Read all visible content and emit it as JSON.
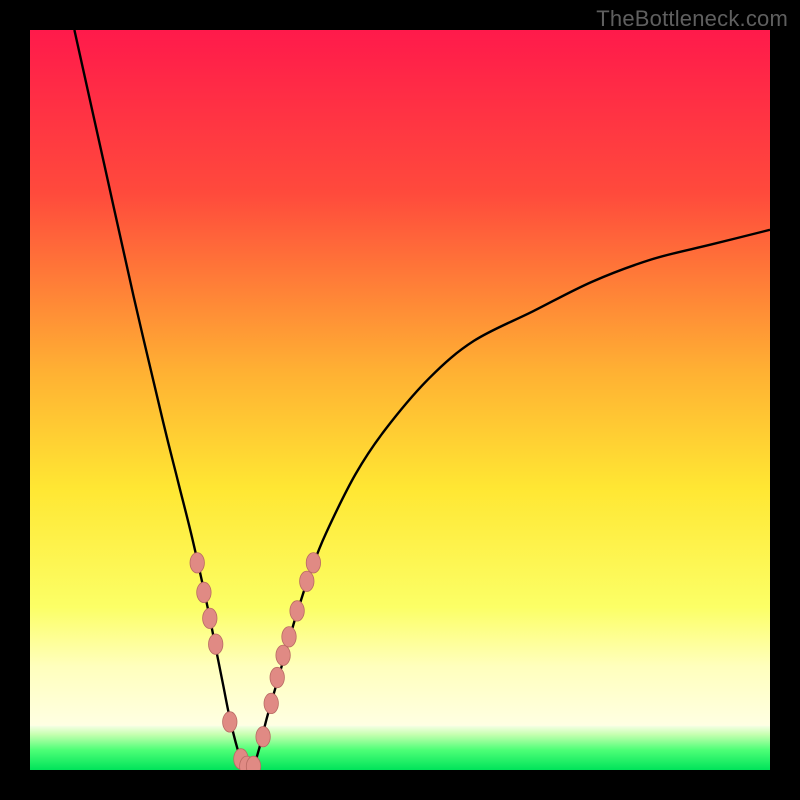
{
  "watermark": {
    "text": "TheBottleneck.com"
  },
  "colors": {
    "black": "#000000",
    "curve": "#000000",
    "marker_fill": "#e08a84",
    "marker_stroke": "#b96a63",
    "gradient_stops": [
      {
        "offset": "0%",
        "color": "#ff1a4b"
      },
      {
        "offset": "22%",
        "color": "#ff4a3c"
      },
      {
        "offset": "46%",
        "color": "#ffb033"
      },
      {
        "offset": "62%",
        "color": "#ffe733"
      },
      {
        "offset": "78%",
        "color": "#fcff66"
      },
      {
        "offset": "86%",
        "color": "#ffffbd"
      },
      {
        "offset": "100%",
        "color": "#ffffff"
      }
    ]
  },
  "chart_data": {
    "type": "line",
    "title": "",
    "xlabel": "",
    "ylabel": "",
    "xlim": [
      0,
      100
    ],
    "ylim": [
      0,
      100
    ],
    "grid": false,
    "legend": false,
    "note": "V-shaped bottleneck curve; y is percentage height. Minimum (~0%) at x≈29. Left branch rises steeply to 100% at x≈6; right branch rises to ~73% at x=100.",
    "series": [
      {
        "name": "bottleneck-curve",
        "x": [
          6,
          10,
          14,
          18,
          20,
          22,
          24,
          25,
          26,
          27,
          28,
          29,
          30,
          31,
          32,
          34,
          36,
          38,
          40,
          44,
          48,
          54,
          60,
          68,
          76,
          84,
          92,
          100
        ],
        "y": [
          100,
          82,
          64,
          47,
          39,
          31,
          22,
          17,
          12,
          7,
          3,
          0,
          0,
          3,
          7,
          14,
          21,
          27,
          32,
          40,
          46,
          53,
          58,
          62,
          66,
          69,
          71,
          73
        ]
      }
    ],
    "markers": {
      "name": "highlighted-points",
      "x": [
        22.6,
        23.5,
        24.3,
        25.1,
        27.0,
        28.5,
        29.3,
        30.2,
        31.5,
        32.6,
        33.4,
        34.2,
        35.0,
        36.1,
        37.4,
        38.3
      ],
      "y": [
        28.0,
        24.0,
        20.5,
        17.0,
        6.5,
        1.5,
        0.5,
        0.5,
        4.5,
        9.0,
        12.5,
        15.5,
        18.0,
        21.5,
        25.5,
        28.0
      ]
    },
    "green_band": {
      "top_pct_from_bottom": 6.0,
      "gradient": [
        {
          "offset": "0%",
          "color": "#f7ffe6"
        },
        {
          "offset": "20%",
          "color": "#c6ffb0"
        },
        {
          "offset": "55%",
          "color": "#4dff77"
        },
        {
          "offset": "100%",
          "color": "#00e35a"
        }
      ]
    }
  }
}
